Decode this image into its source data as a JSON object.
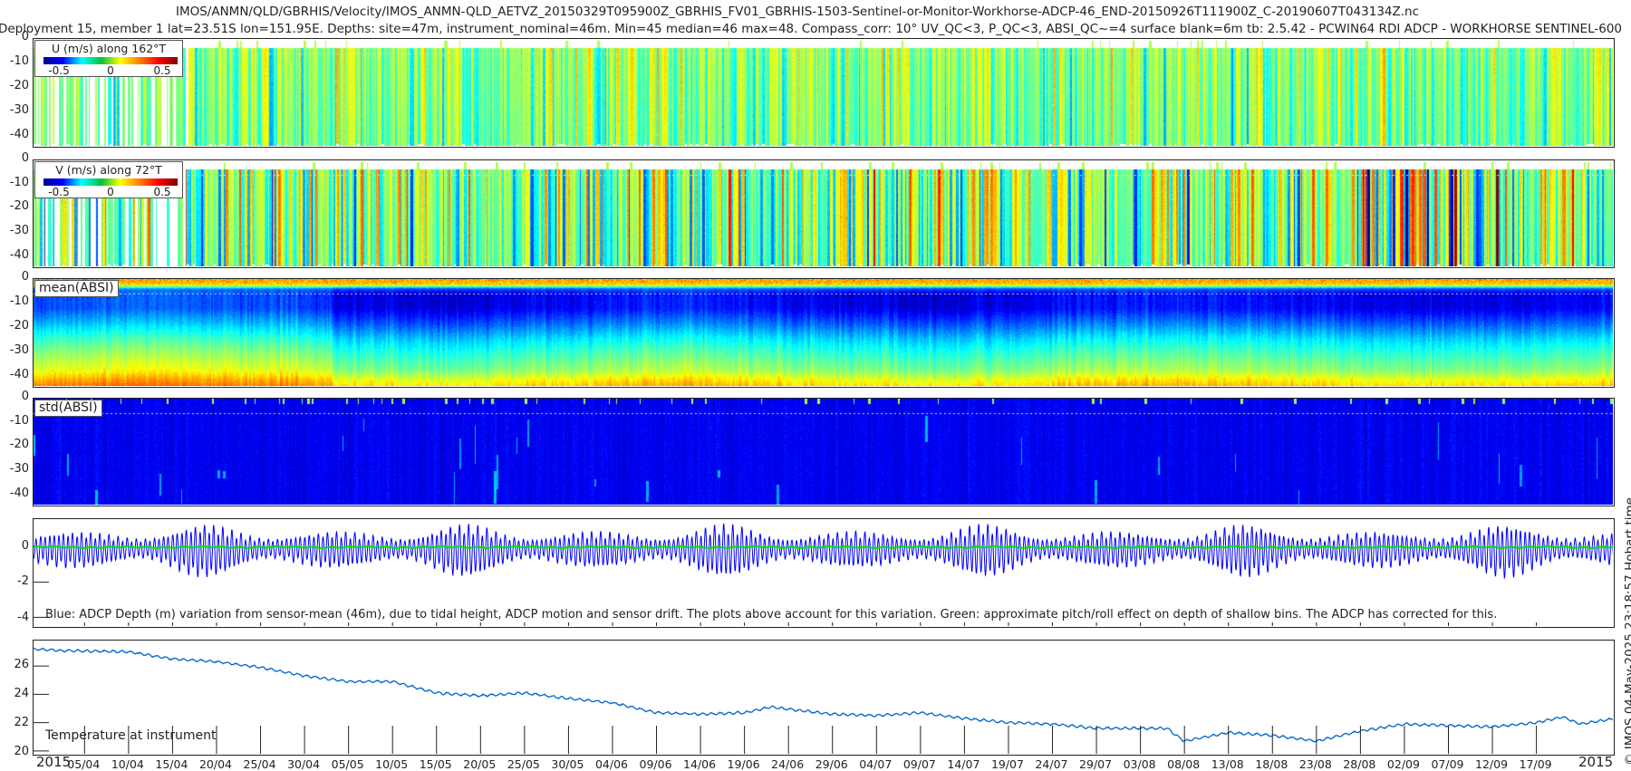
{
  "title": {
    "line1": "IMOS/ANMN/QLD/GBRHIS/Velocity/IMOS_ANMN-QLD_AETVZ_20150329T095900Z_GBRHIS_FV01_GBRHIS-1503-Sentinel-or-Monitor-Workhorse-ADCP-46_END-20150926T111900Z_C-20190607T043134Z.nc",
    "line2": "Deployment 15, member 1 lat=23.51S lon=151.95E. Depths: site=47m, instrument_nominal=46m. Min=45 median=46 max=48. Compass_corr: 10° UV_QC<3, P_QC<3, ABSI_QC~=4 surface blank=6m tb: 2.5.42 - PCWIN64 RDI ADCP - WORKHORSE SENTINEL-600"
  },
  "depth_ticks": [
    "0",
    "-10",
    "-20",
    "-30",
    "-40"
  ],
  "depth_tick_values": [
    0,
    -10,
    -20,
    -30,
    -40
  ],
  "panels": {
    "u": {
      "legend_title": "U (m/s) along 162°T",
      "colorbar_ticks": [
        "-0.5",
        "0",
        "0.5"
      ]
    },
    "v": {
      "legend_title": "V (m/s) along 72°T",
      "colorbar_ticks": [
        "-0.5",
        "0",
        "0.5"
      ]
    },
    "mean_absi": {
      "label": "mean(ABSI)"
    },
    "std_absi": {
      "label": "std(ABSI)"
    },
    "depth_var": {
      "ticks": [
        "0",
        "-2",
        "-4"
      ],
      "tick_values": [
        0,
        -2,
        -4
      ],
      "note": "Blue: ADCP Depth (m) variation from sensor-mean (46m), due to tidal height, ADCP motion and sensor drift. The plots above account for this variation. Green: approximate pitch/roll effect on depth of shallow bins. The ADCP has corrected for this."
    },
    "temperature": {
      "label": "Temperature at instrument",
      "ticks": [
        "26",
        "24",
        "22",
        "20"
      ],
      "tick_values": [
        26,
        24,
        22,
        20
      ]
    }
  },
  "x_axis": {
    "ticks": [
      "05/04",
      "10/04",
      "15/04",
      "20/04",
      "25/04",
      "30/04",
      "05/05",
      "10/05",
      "15/05",
      "20/05",
      "25/05",
      "30/05",
      "04/06",
      "09/06",
      "14/06",
      "19/06",
      "24/06",
      "29/06",
      "04/07",
      "09/07",
      "14/07",
      "19/07",
      "24/07",
      "29/07",
      "03/08",
      "08/08",
      "13/08",
      "18/08",
      "23/08",
      "28/08",
      "02/09",
      "07/09",
      "12/09",
      "17/09"
    ],
    "year_left": "2015",
    "year_right": "2015"
  },
  "credit": "© IMOS 04-May-2025 23:18:57 Hobart time",
  "chart_data": [
    {
      "type": "heatmap",
      "name": "U velocity",
      "colormap": "jet",
      "clim": [
        -0.7,
        0.7
      ],
      "ylim": [
        -45,
        0
      ],
      "xlim_day_of_year": [
        88.2,
        268.0
      ],
      "typical_value": 0.0,
      "spread": 0.2
    },
    {
      "type": "heatmap",
      "name": "V velocity",
      "colormap": "jet",
      "clim": [
        -0.7,
        0.7
      ],
      "ylim": [
        -45,
        0
      ],
      "xlim_day_of_year": [
        88.2,
        268.0
      ],
      "typical_value": 0.0,
      "spread": 0.35
    },
    {
      "type": "heatmap",
      "name": "mean(ABSI)",
      "colormap": "jet",
      "ylim": [
        -45,
        0
      ],
      "profile_depth": [
        0,
        -2,
        -3,
        -4,
        -6,
        -12,
        -18,
        -25,
        -32,
        -38,
        -42,
        -45
      ],
      "profile_level": [
        0.72,
        0.68,
        0.45,
        0.2,
        0.12,
        0.12,
        0.22,
        0.35,
        0.45,
        0.52,
        0.62,
        0.68
      ]
    },
    {
      "type": "heatmap",
      "name": "std(ABSI)",
      "colormap": "jet",
      "ylim": [
        -45,
        0
      ],
      "typical_level": 0.11
    },
    {
      "type": "line",
      "name": "ADCP depth variation (m)",
      "ylim": [
        -4.5,
        1.6
      ],
      "tide_period_hours": 12.42,
      "spring_neap_days": 14.77,
      "spring_day_of_year": 107.7,
      "amplitude_range_m": [
        0.45,
        1.6
      ],
      "series_colors": {
        "depth": "#0000ff",
        "pitch_roll": "#00e000"
      }
    },
    {
      "type": "line",
      "name": "Temperature at instrument",
      "ylim": [
        19.8,
        27.8
      ],
      "color": "#0066cc",
      "x": [
        "30/03",
        "02/04",
        "10/04",
        "15/04",
        "20/04",
        "25/04",
        "30/04",
        "05/05",
        "10/05",
        "15/05",
        "20/05",
        "25/05",
        "30/05",
        "04/06",
        "09/06",
        "14/06",
        "19/06",
        "22/06",
        "29/06",
        "04/07",
        "09/07",
        "14/07",
        "19/07",
        "24/07",
        "29/07",
        "03/08",
        "06/08",
        "08/08",
        "13/08",
        "18/08",
        "23/08",
        "28/08",
        "02/09",
        "07/09",
        "12/09",
        "17/09",
        "20/09",
        "22/09",
        "26/09"
      ],
      "y": [
        27.2,
        27.1,
        27.0,
        26.5,
        26.3,
        25.9,
        25.3,
        24.9,
        24.9,
        24.1,
        23.9,
        24.1,
        23.7,
        23.4,
        22.7,
        22.6,
        22.7,
        23.1,
        22.6,
        22.5,
        22.7,
        22.3,
        22.0,
        21.9,
        21.6,
        21.6,
        21.6,
        20.7,
        21.3,
        21.1,
        20.7,
        21.4,
        21.9,
        21.8,
        21.7,
        22.0,
        22.4,
        21.9,
        22.3
      ]
    }
  ]
}
